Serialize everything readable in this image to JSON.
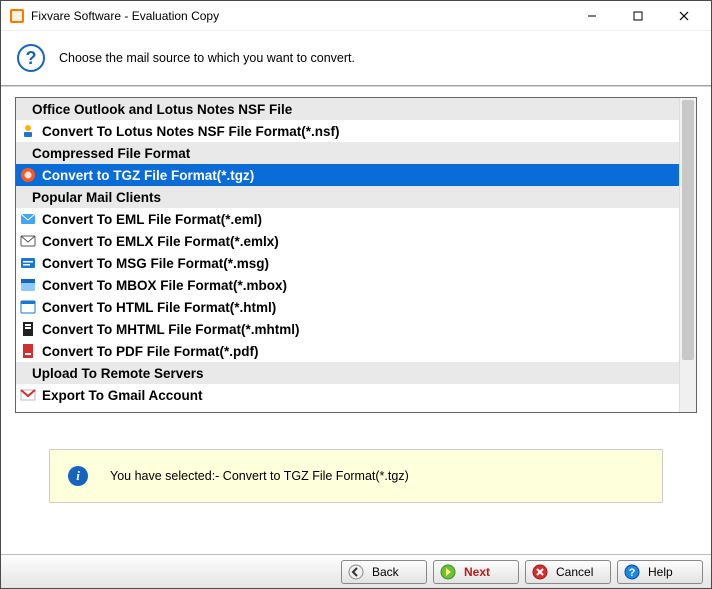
{
  "title": "Fixvare Software - Evaluation Copy",
  "header_text": "Choose the mail source to which you want to convert.",
  "rows": [
    {
      "kind": "group",
      "label": "Office Outlook and Lotus Notes NSF File"
    },
    {
      "kind": "item",
      "label": "Convert To Lotus Notes NSF File Format(*.nsf)",
      "icon": "nsf",
      "selected": false
    },
    {
      "kind": "group",
      "label": "Compressed File Format"
    },
    {
      "kind": "item",
      "label": "Convert to TGZ File Format(*.tgz)",
      "icon": "tgz",
      "selected": true
    },
    {
      "kind": "group",
      "label": "Popular Mail Clients"
    },
    {
      "kind": "item",
      "label": "Convert To EML File Format(*.eml)",
      "icon": "eml",
      "selected": false
    },
    {
      "kind": "item",
      "label": "Convert To EMLX File Format(*.emlx)",
      "icon": "emlx",
      "selected": false
    },
    {
      "kind": "item",
      "label": "Convert To MSG File Format(*.msg)",
      "icon": "msg",
      "selected": false
    },
    {
      "kind": "item",
      "label": "Convert To MBOX File Format(*.mbox)",
      "icon": "mbox",
      "selected": false
    },
    {
      "kind": "item",
      "label": "Convert To HTML File Format(*.html)",
      "icon": "html",
      "selected": false
    },
    {
      "kind": "item",
      "label": "Convert To MHTML File Format(*.mhtml)",
      "icon": "mhtml",
      "selected": false
    },
    {
      "kind": "item",
      "label": "Convert To PDF File Format(*.pdf)",
      "icon": "pdf",
      "selected": false
    },
    {
      "kind": "group",
      "label": "Upload To Remote Servers"
    },
    {
      "kind": "item",
      "label": "Export To Gmail Account",
      "icon": "gmail",
      "selected": false
    }
  ],
  "info_text": "You have selected:- Convert to TGZ File Format(*.tgz)",
  "buttons": {
    "back": "Back",
    "next": "Next",
    "cancel": "Cancel",
    "help": "Help"
  }
}
